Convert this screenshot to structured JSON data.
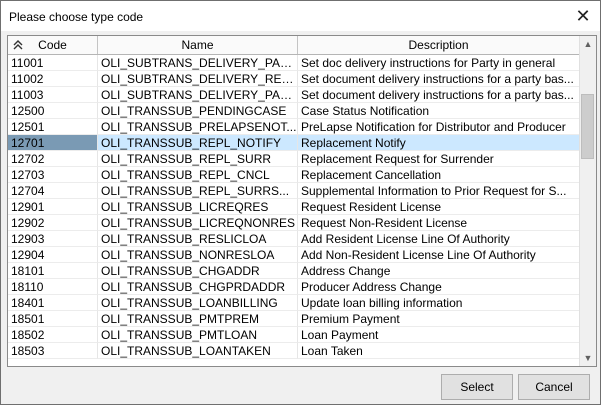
{
  "dialog": {
    "title": "Please choose type code",
    "close_glyph": "✕"
  },
  "table": {
    "columns": [
      "Code",
      "Name",
      "Description"
    ],
    "sort_icon": "double-chevron-up-icon",
    "selected_index": 5,
    "rows": [
      {
        "code": "11001",
        "name": "OLI_SUBTRANS_DELIVERY_PAR...",
        "desc": "Set doc delivery instructions for Party in general"
      },
      {
        "code": "11002",
        "name": "OLI_SUBTRANS_DELIVERY_REL...",
        "desc": "Set document delivery instructions for a party bas..."
      },
      {
        "code": "11003",
        "name": "OLI_SUBTRANS_DELIVERY_PAR...",
        "desc": "Set document delivery instructions for a party bas..."
      },
      {
        "code": "12500",
        "name": "OLI_TRANSSUB_PENDINGCASE",
        "desc": "Case Status Notification"
      },
      {
        "code": "12501",
        "name": "OLI_TRANSSUB_PRELAPSENOT...",
        "desc": "PreLapse Notification for Distributor and Producer"
      },
      {
        "code": "12701",
        "name": "OLI_TRANSSUB_REPL_NOTIFY",
        "desc": "Replacement Notify"
      },
      {
        "code": "12702",
        "name": "OLI_TRANSSUB_REPL_SURR",
        "desc": "Replacement Request for Surrender"
      },
      {
        "code": "12703",
        "name": "OLI_TRANSSUB_REPL_CNCL",
        "desc": "Replacement Cancellation"
      },
      {
        "code": "12704",
        "name": "OLI_TRANSSUB_REPL_SURRS...",
        "desc": "Supplemental Information to Prior Request for S..."
      },
      {
        "code": "12901",
        "name": "OLI_TRANSSUB_LICREQRES",
        "desc": "Request Resident License"
      },
      {
        "code": "12902",
        "name": "OLI_TRANSSUB_LICREQNONRES",
        "desc": "Request Non-Resident License"
      },
      {
        "code": "12903",
        "name": "OLI_TRANSSUB_RESLICLOA",
        "desc": "Add Resident License Line Of Authority"
      },
      {
        "code": "12904",
        "name": "OLI_TRANSSUB_NONRESLOA",
        "desc": "Add Non-Resident License Line Of Authority"
      },
      {
        "code": "18101",
        "name": "OLI_TRANSSUB_CHGADDR",
        "desc": "Address Change"
      },
      {
        "code": "18110",
        "name": "OLI_TRANSSUB_CHGPRDADDR",
        "desc": "Producer Address Change"
      },
      {
        "code": "18401",
        "name": "OLI_TRANSSUB_LOANBILLING",
        "desc": "Update loan billing information"
      },
      {
        "code": "18501",
        "name": "OLI_TRANSSUB_PMTPREM",
        "desc": "Premium Payment"
      },
      {
        "code": "18502",
        "name": "OLI_TRANSSUB_PMTLOAN",
        "desc": "Loan Payment"
      },
      {
        "code": "18503",
        "name": "OLI_TRANSSUB_LOANTAKEN",
        "desc": "Loan Taken"
      }
    ]
  },
  "scrollbar": {
    "thumb_start_fraction": 0.14,
    "thumb_size_fraction": 0.22,
    "up_glyph": "▲",
    "down_glyph": "▼"
  },
  "buttons": {
    "select_label": "Select",
    "cancel_label": "Cancel"
  }
}
